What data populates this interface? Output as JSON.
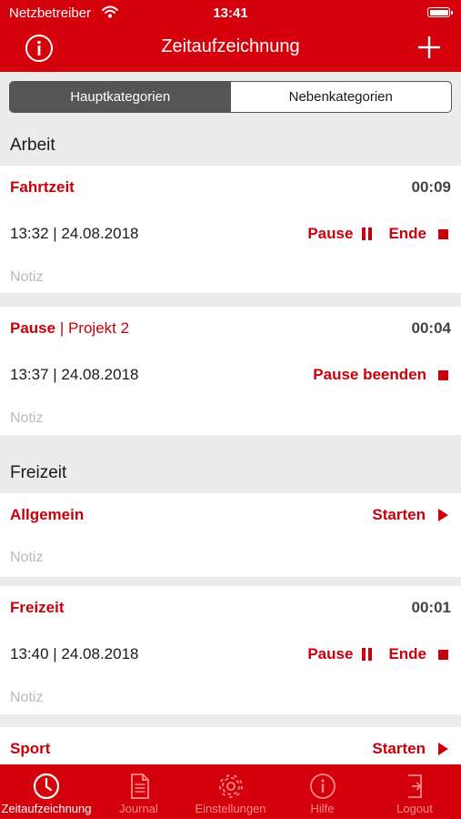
{
  "status_bar": {
    "carrier": "Netzbetreiber",
    "time": "13:41"
  },
  "nav": {
    "title": "Zeitaufzeichnung",
    "left_icon": "info-icon",
    "right_icon": "plus-icon"
  },
  "segment": {
    "options": [
      "Hauptkategorien",
      "Nebenkategorien"
    ],
    "selected": "Hauptkategorien"
  },
  "sections": [
    {
      "title": "Arbeit",
      "items": [
        {
          "name": "Fahrtzeit",
          "duration": "00:09",
          "start": "13:32 | 24.08.2018",
          "pause_label": "Pause",
          "end_label": "Ende",
          "note_placeholder": "Notiz"
        },
        {
          "name": "Pause",
          "project": "| Projekt 2",
          "duration": "00:04",
          "start": "13:37 | 24.08.2018",
          "resume_label": "Pause beenden",
          "note_placeholder": "Notiz"
        }
      ]
    },
    {
      "title": "Freizeit",
      "items": [
        {
          "name": "Allgemein",
          "start_label": "Starten",
          "note_placeholder": "Notiz"
        },
        {
          "name": "Freizeit",
          "duration": "00:01",
          "start": "13:40 | 24.08.2018",
          "pause_label": "Pause",
          "end_label": "Ende",
          "note_placeholder": "Notiz"
        },
        {
          "name": "Sport",
          "start_label": "Starten"
        }
      ]
    }
  ],
  "tabbar": {
    "tabs": [
      {
        "label": "Zeitaufzeichnung",
        "icon": "clock-icon",
        "active": true
      },
      {
        "label": "Journal",
        "icon": "document-icon",
        "active": false
      },
      {
        "label": "Einstellungen",
        "icon": "gear-icon",
        "active": false
      },
      {
        "label": "Hilfe",
        "icon": "info-icon",
        "active": false
      },
      {
        "label": "Logout",
        "icon": "logout-icon",
        "active": false
      }
    ]
  },
  "colors": {
    "brand": "#d4000b",
    "accent_text": "#c8000a",
    "background": "#ececec",
    "placeholder": "#b9b9b9"
  }
}
